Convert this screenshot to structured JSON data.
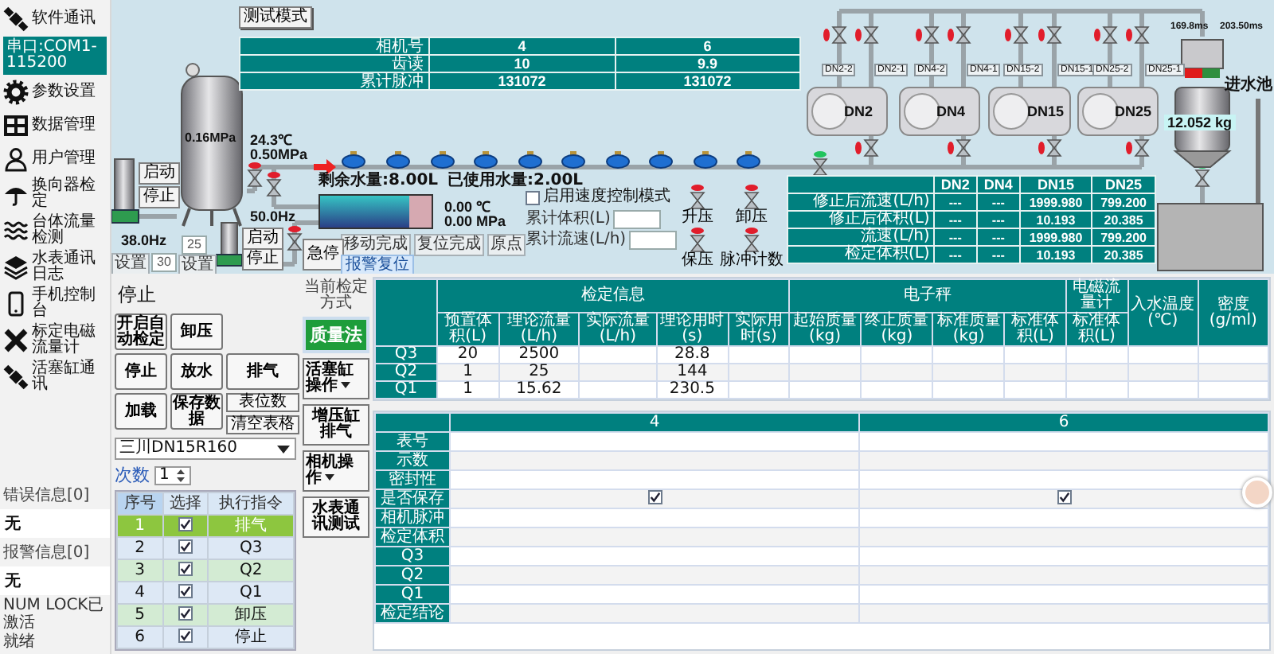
{
  "sidebar": {
    "items": [
      {
        "kind": "nav",
        "label": "软件通讯"
      },
      {
        "kind": "port",
        "label": "串口:COM1-115200"
      },
      {
        "kind": "nav",
        "label": "参数设置"
      },
      {
        "kind": "nav",
        "label": "数据管理"
      },
      {
        "kind": "nav",
        "label": "用户管理"
      },
      {
        "kind": "nav",
        "label": "换向器检定"
      },
      {
        "kind": "nav",
        "label": "台体流量检测"
      },
      {
        "kind": "nav",
        "label": "水表通讯日志"
      },
      {
        "kind": "nav",
        "label": "手机控制台"
      },
      {
        "kind": "nav",
        "label": "标定电磁流量计"
      },
      {
        "kind": "nav",
        "label": "活塞缸通讯"
      }
    ]
  },
  "status": {
    "error_label": "错误信息[0]",
    "error_value": "无",
    "alarm_label": "报警信息[0]",
    "alarm_value": "无"
  },
  "status_bar": [
    "NUM LOCK已激活",
    "就绪"
  ],
  "diagram": {
    "mode_button": "测试模式",
    "meter_table": {
      "rows": [
        {
          "label": "相机号",
          "values": [
            "4",
            "6"
          ]
        },
        {
          "label": "齿读",
          "values": [
            "10",
            "9.9"
          ]
        },
        {
          "label": "累计脉冲",
          "values": [
            "131072",
            "131072"
          ]
        }
      ]
    },
    "tank_pressure": "0.16MPa",
    "pumps": [
      {
        "frequency": "38.0Hz",
        "setting": "30",
        "set_button": "设置",
        "start_button": "启动",
        "stop_button": "停止"
      },
      {
        "frequency": "50.0Hz",
        "setting": "25",
        "set_button": "设置",
        "start_button": "启动",
        "stop_button": "停止"
      }
    ],
    "inlet": {
      "temperature": "24.3℃",
      "pressure": "0.50MPa"
    },
    "remaining": "剩余水量:8.00L",
    "used": "已使用水量:2.00L",
    "cylinder": {
      "level": 0.8,
      "temperature": "0.00 ℃",
      "pressure": "0.00 MPa",
      "buttons": [
        "移动完成",
        "复位完成",
        "原点"
      ],
      "estop": "急停",
      "reset": "报警复位"
    },
    "speed_mode": {
      "label": "启用速度控制模式",
      "checked": false
    },
    "fields": [
      {
        "label": "累计体积(L)"
      },
      {
        "label": "累计流速(L/h)"
      }
    ],
    "valve_buttons": [
      {
        "label": "升压",
        "open": false
      },
      {
        "label": "卸压",
        "open": false
      },
      {
        "label": "保压",
        "open": false
      },
      {
        "label": "脉冲计数",
        "open": false
      }
    ],
    "valves": [
      {
        "open": false
      },
      {
        "open": false
      },
      {
        "open": false
      },
      {
        "open": false
      },
      {
        "open": false
      },
      {
        "open": false
      },
      {
        "open": false
      },
      {
        "open": false
      },
      {
        "open": false
      },
      {
        "open": false
      },
      {
        "open": false
      },
      {
        "open": false
      },
      {
        "open": false
      },
      {
        "open": false
      },
      {
        "open": false
      },
      {
        "open": true
      },
      {
        "open": true
      }
    ],
    "flowmeters": [
      {
        "name": "DN2",
        "ports": [
          "DN2-2",
          "DN2-1"
        ]
      },
      {
        "name": "DN4",
        "ports": [
          "DN4-2",
          "DN4-1"
        ]
      },
      {
        "name": "DN15",
        "ports": [
          "DN15-2",
          "DN15-1"
        ]
      },
      {
        "name": "DN25",
        "ports": [
          "DN25-2",
          "DN25-1"
        ]
      }
    ],
    "flow_table": {
      "columns": [
        "DN2",
        "DN4",
        "DN15",
        "DN25"
      ],
      "rows": [
        {
          "label": "修正后流速(L/h)",
          "values": [
            "---",
            "---",
            "1999.980",
            "799.200"
          ]
        },
        {
          "label": "修正后体积(L)",
          "values": [
            "---",
            "---",
            "10.193",
            "20.385"
          ]
        },
        {
          "label": "流速(L/h)",
          "values": [
            "---",
            "---",
            "1999.980",
            "799.200"
          ]
        },
        {
          "label": "检定体积(L)",
          "values": [
            "---",
            "---",
            "10.193",
            "20.385"
          ]
        }
      ]
    },
    "timings": [
      "169.8ms",
      "203.50ms"
    ],
    "pool": "进水池",
    "scale": "12.052 kg"
  },
  "controls": {
    "method_label": "当前检定方式",
    "method": "质量法",
    "state": "停止",
    "buttons": [
      "开启自动检定",
      "卸压",
      "停止",
      "放水",
      "排气",
      "加载",
      "保存数据"
    ],
    "small_buttons": [
      "表位数",
      "清空表格"
    ],
    "side_controls": [
      {
        "kind": "dropdown",
        "label": "活塞缸操作"
      },
      {
        "kind": "button",
        "label": "增压缸排气"
      },
      {
        "kind": "dropdown",
        "label": "相机操作"
      },
      {
        "kind": "button",
        "label": "水表通讯测试"
      }
    ],
    "meter_model": "三川DN15R160",
    "count_label": "次数",
    "count": "1",
    "steps": {
      "columns": [
        "序号",
        "选择",
        "执行指令"
      ],
      "rows": [
        {
          "index": "1",
          "checked": true,
          "command": "排气",
          "selected": true
        },
        {
          "index": "2",
          "checked": true,
          "command": "Q3",
          "selected": false
        },
        {
          "index": "3",
          "checked": true,
          "command": "Q2",
          "selected": false
        },
        {
          "index": "4",
          "checked": true,
          "command": "Q1",
          "selected": false
        },
        {
          "index": "5",
          "checked": true,
          "command": "卸压",
          "selected": false
        },
        {
          "index": "6",
          "checked": true,
          "command": "停止",
          "selected": false
        }
      ]
    }
  },
  "test_table": {
    "groups": [
      {
        "label": "检定信息",
        "columns": [
          "预置体积(L)",
          "理论流量(L/h)",
          "实际流量(L/h)",
          "理论用时(s)",
          "实际用时(s)"
        ]
      },
      {
        "label": "电子秤",
        "columns": [
          "起始质量(kg)",
          "终止质量(kg)",
          "标准质量(kg)",
          "标准体积(L)"
        ]
      },
      {
        "label": "电磁流量计",
        "columns": [
          "标准体积(L)"
        ]
      }
    ],
    "single_columns": [
      "入水温度(℃)",
      "密度(g/ml)"
    ],
    "rows": [
      {
        "label": "Q3",
        "preset_volume": "20",
        "theoretical_flow": "2500",
        "theoretical_time": "28.8"
      },
      {
        "label": "Q2",
        "preset_volume": "1",
        "theoretical_flow": "25",
        "theoretical_time": "144"
      },
      {
        "label": "Q1",
        "preset_volume": "1",
        "theoretical_flow": "15.62",
        "theoretical_time": "230.5"
      }
    ]
  },
  "result_table": {
    "columns": [
      "4",
      "6"
    ],
    "rows": [
      {
        "label": "表号",
        "kind": "text"
      },
      {
        "label": "示数",
        "kind": "text"
      },
      {
        "label": "密封性",
        "kind": "text"
      },
      {
        "label": "是否保存",
        "kind": "check",
        "values": [
          {
            "checked": true
          },
          {
            "checked": true
          }
        ]
      },
      {
        "label": "相机脉冲",
        "kind": "text"
      },
      {
        "label": "检定体积",
        "kind": "text"
      },
      {
        "label": "Q3",
        "kind": "text"
      },
      {
        "label": "Q2",
        "kind": "text"
      },
      {
        "label": "Q1",
        "kind": "text"
      },
      {
        "label": "检定结论",
        "kind": "text"
      }
    ]
  }
}
